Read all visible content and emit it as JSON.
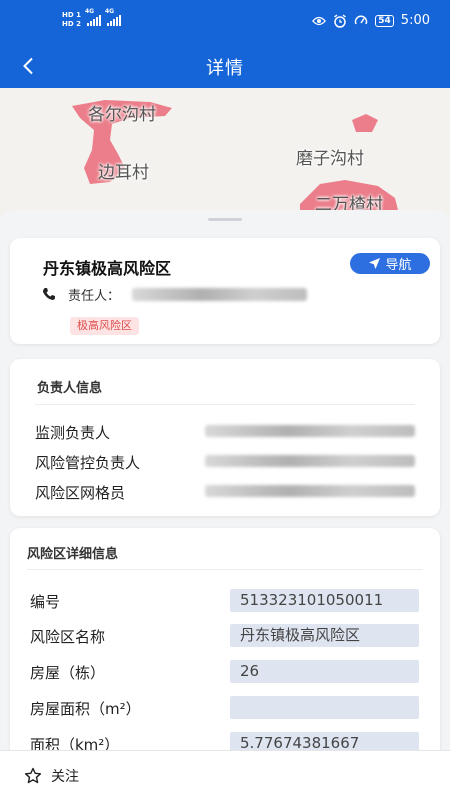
{
  "status_bar": {
    "sim1": "HD 1",
    "sim2": "HD 2",
    "net1": "4G",
    "net2": "4G",
    "battery": "54",
    "time": "5:00"
  },
  "nav": {
    "title": "详情",
    "back_icon": "chevron-left-icon"
  },
  "map": {
    "labels": [
      "各尔沟村",
      "边耳村",
      "磨子沟村",
      "二万楂村"
    ],
    "region_color": "#e96a78"
  },
  "area_card": {
    "title": "丹东镇极高风险区",
    "navigate_label": "导航",
    "responsible_label": "责任人：",
    "risk_badge": "极高风险区"
  },
  "person_card": {
    "title": "负责人信息",
    "rows": [
      {
        "label": "监测负责人"
      },
      {
        "label": "风险管控负责人"
      },
      {
        "label": "风险区网格员"
      }
    ]
  },
  "detail_card": {
    "title": "风险区详细信息",
    "fields": [
      {
        "label": "编号",
        "value": "513323101050011"
      },
      {
        "label": "风险区名称",
        "value": "丹东镇极高风险区"
      },
      {
        "label": "房屋（栋）",
        "value": "26"
      },
      {
        "label": "房屋面积（m²）",
        "value": ""
      },
      {
        "label": "面积（km²）",
        "value": "5.77674381667"
      }
    ]
  },
  "bottom_bar": {
    "follow_label": "关注",
    "follow_icon": "star-outline-icon"
  },
  "colors": {
    "primary": "#1565d8",
    "button": "#2d6fe0",
    "badge_bg": "#fde3e3",
    "badge_text": "#e04b4b"
  }
}
